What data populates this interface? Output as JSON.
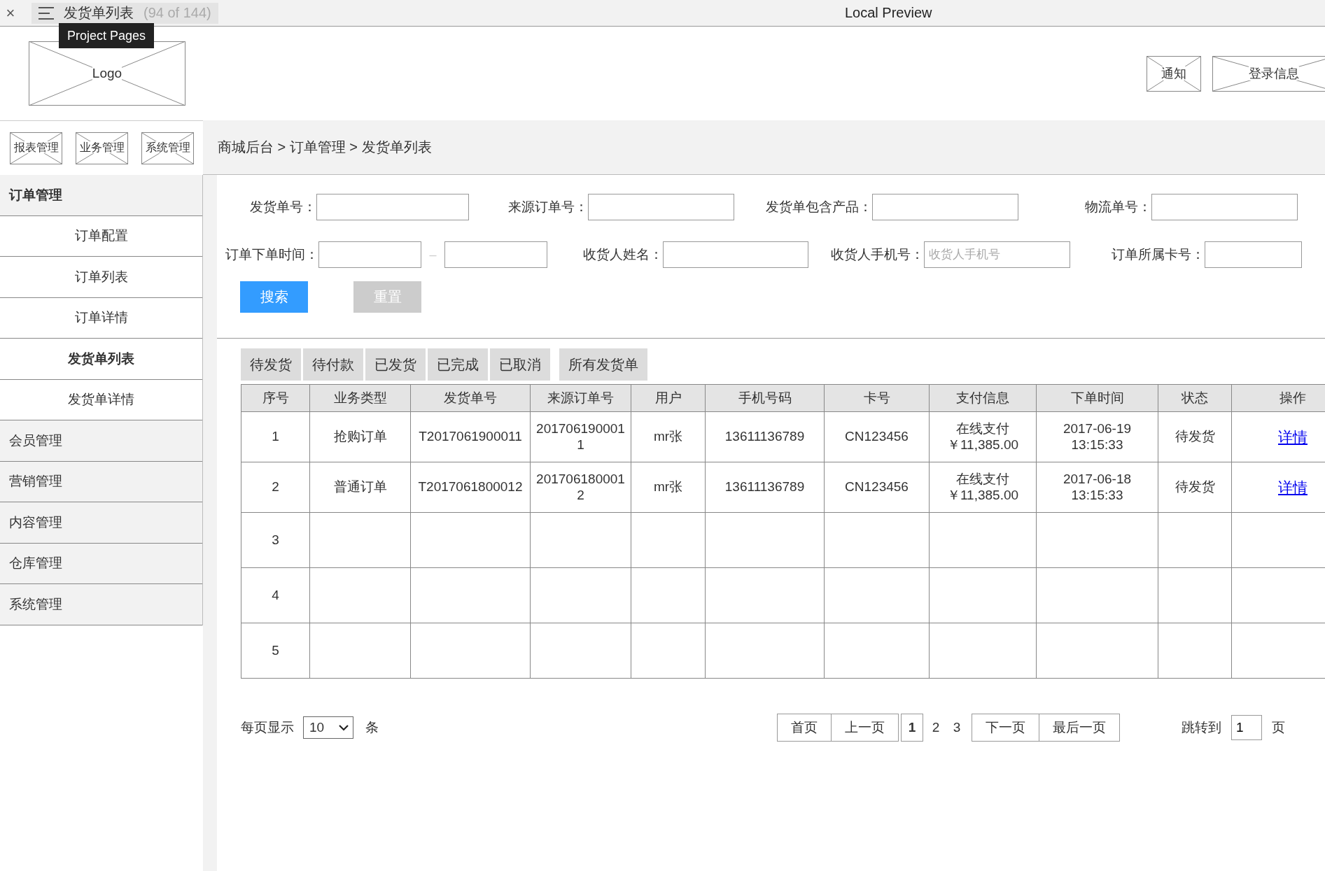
{
  "window": {
    "close": "×",
    "tab_title": "发货单列表",
    "tab_count": "(94 of 144)",
    "title": "Local Preview",
    "tooltip": "Project Pages"
  },
  "header": {
    "logo": "Logo",
    "buttons": [
      "通知",
      "登录信息"
    ]
  },
  "nav_buttons": [
    "报表管理",
    "业务管理",
    "系统管理"
  ],
  "breadcrumb": "商城后台 > 订单管理 > 发货单列表",
  "sidebar": {
    "groups": [
      {
        "label": "订单管理",
        "expanded": true,
        "children": [
          {
            "label": "订单配置",
            "selected": false
          },
          {
            "label": "订单列表",
            "selected": false
          },
          {
            "label": "订单详情",
            "selected": false
          },
          {
            "label": "发货单列表",
            "selected": true
          },
          {
            "label": "发货单详情",
            "selected": false
          }
        ]
      },
      {
        "label": "会员管理",
        "expanded": false
      },
      {
        "label": "营销管理",
        "expanded": false
      },
      {
        "label": "内容管理",
        "expanded": false
      },
      {
        "label": "仓库管理",
        "expanded": false
      },
      {
        "label": "系统管理",
        "expanded": false
      }
    ]
  },
  "filters": {
    "rows": [
      [
        {
          "label": "发货单号：",
          "kind": "text"
        },
        {
          "label": "来源订单号：",
          "kind": "text"
        },
        {
          "label": "发货单包含产品：",
          "kind": "text"
        },
        {
          "label": "物流单号：",
          "kind": "text"
        }
      ],
      [
        {
          "label": "订单下单时间：",
          "kind": "range",
          "separator": "–"
        },
        {
          "label": "收货人姓名：",
          "kind": "text"
        },
        {
          "label": "收货人手机号：",
          "kind": "text",
          "placeholder": "收货人手机号"
        },
        {
          "label": "订单所属卡号：",
          "kind": "text"
        }
      ]
    ],
    "search_button": "搜索",
    "reset_button": "重置"
  },
  "status_tabs": [
    "待发货",
    "待付款",
    "已发货",
    "已完成",
    "已取消",
    "所有发货单"
  ],
  "table": {
    "columns": [
      "序号",
      "业务类型",
      "发货单号",
      "来源订单号",
      "用户",
      "手机号码",
      "卡号",
      "支付信息",
      "下单时间",
      "状态",
      "操作"
    ],
    "rows": [
      {
        "cells": [
          "1",
          "抢购订单",
          "T2017061900011",
          "2017061900011",
          "mr张",
          "13611136789",
          "CN123456",
          [
            "在线支付",
            "￥11,385.00"
          ],
          "2017-06-19\n13:15:33",
          "待发货"
        ],
        "action": "详情"
      },
      {
        "cells": [
          "2",
          "普通订单",
          "T2017061800012",
          "2017061800012",
          "mr张",
          "13611136789",
          "CN123456",
          [
            "在线支付",
            "￥11,385.00"
          ],
          "2017-06-18\n13:15:33",
          "待发货"
        ],
        "action": "详情"
      },
      {
        "cells": [
          "3"
        ]
      },
      {
        "cells": [
          "4"
        ]
      },
      {
        "cells": [
          "5"
        ]
      }
    ]
  },
  "pagination": {
    "per_page_label": "每页显示",
    "per_page": "10",
    "per_page_unit": "条",
    "first": "首页",
    "prev": "上一页",
    "pages": [
      {
        "label": "1",
        "selected": true
      },
      {
        "label": "2",
        "selected": false
      },
      {
        "label": "3",
        "selected": false
      }
    ],
    "next": "下一页",
    "last": "最后一页",
    "jump_label": "跳转到",
    "jump_value": "1",
    "jump_unit": "页"
  }
}
